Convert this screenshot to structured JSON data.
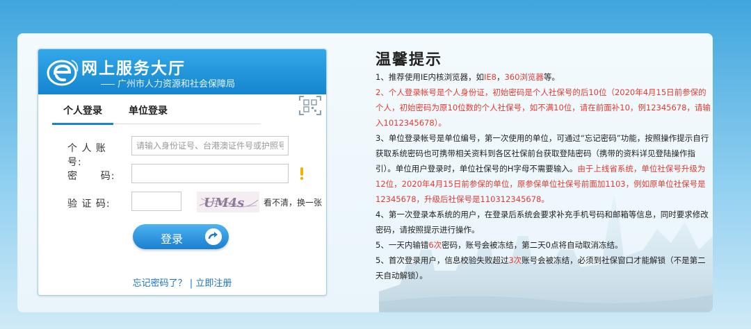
{
  "header": {
    "title": "网上服务大厅",
    "subtitle": "广州市人力资源和社会保障局"
  },
  "tabs": [
    {
      "label": "个人登录",
      "active": true
    },
    {
      "label": "单位登录",
      "active": false
    }
  ],
  "form": {
    "account_label": "个 人 账 号:",
    "account_placeholder": "请输入身份证号、台港澳证件号或护照号",
    "password_label": "密      码:",
    "captcha_label": "验 证 码:",
    "captcha_text": "UM4s",
    "captcha_refresh": "看不清，换一张",
    "login_button": "登录",
    "forgot_link": "忘记密码了？",
    "separator": "|",
    "register_link": "立即注册"
  },
  "tips": {
    "title": "温馨提示",
    "items": [
      {
        "parts": [
          {
            "text": "1、推荐使用IE内核浏览器，如",
            "red": false
          },
          {
            "text": "IE8",
            "red": true
          },
          {
            "text": "，",
            "red": false
          },
          {
            "text": "360浏览器",
            "red": true
          },
          {
            "text": "等。",
            "red": false
          }
        ]
      },
      {
        "parts": [
          {
            "text": "2、个人登录帐号是个人身份证，初始密码是个人社保号的后10位（2020年4月15日前参保的个人，初始密码为原10位数的个人社保号，如不满10位，请在前面补10，例12345678，请输入1012345678）。",
            "red": true
          }
        ]
      },
      {
        "parts": [
          {
            "text": "3、单位登录帐号是单位编号，第一次使用的单位，可通过“忘记密码”功能，按照操作提示自行获取系统密码也可携带相关资料到各区社保前台获取登陆密码（携带的资料详见登陆操作指引）。单位用户登录时，单位社保号的H字母不需要输入。",
            "red": false
          },
          {
            "text": "由于上线省系统，单位社保号升级为12位，2020年4月15日前参保的单位，原参保单位社保号前面加1103，例如原单位社保号是12345678，升级后社保号是110312345678。",
            "red": true
          }
        ]
      },
      {
        "parts": [
          {
            "text": "4、第一次登录本系统的用户，在登录后系统会要求补充手机号码和邮箱等信息，同时要求修改密码，请按照提示进行操作。",
            "red": false
          }
        ]
      },
      {
        "parts": [
          {
            "text": "5、一天内输错",
            "red": false
          },
          {
            "text": "6次",
            "red": true
          },
          {
            "text": "密码，账号会被冻结，第二天0点将自动取消冻结。",
            "red": false
          }
        ]
      },
      {
        "parts": [
          {
            "text": "5、首次登录用户，信息校验失败超过",
            "red": false
          },
          {
            "text": "3次",
            "red": true
          },
          {
            "text": "账号会被冻结，必须到社保窗口才能解锁（不是第二天自动解锁）。",
            "red": false
          }
        ]
      }
    ]
  },
  "colors": {
    "accent": "#1483d1",
    "warning": "#f0b400",
    "tip_red": "#e53a2f"
  }
}
